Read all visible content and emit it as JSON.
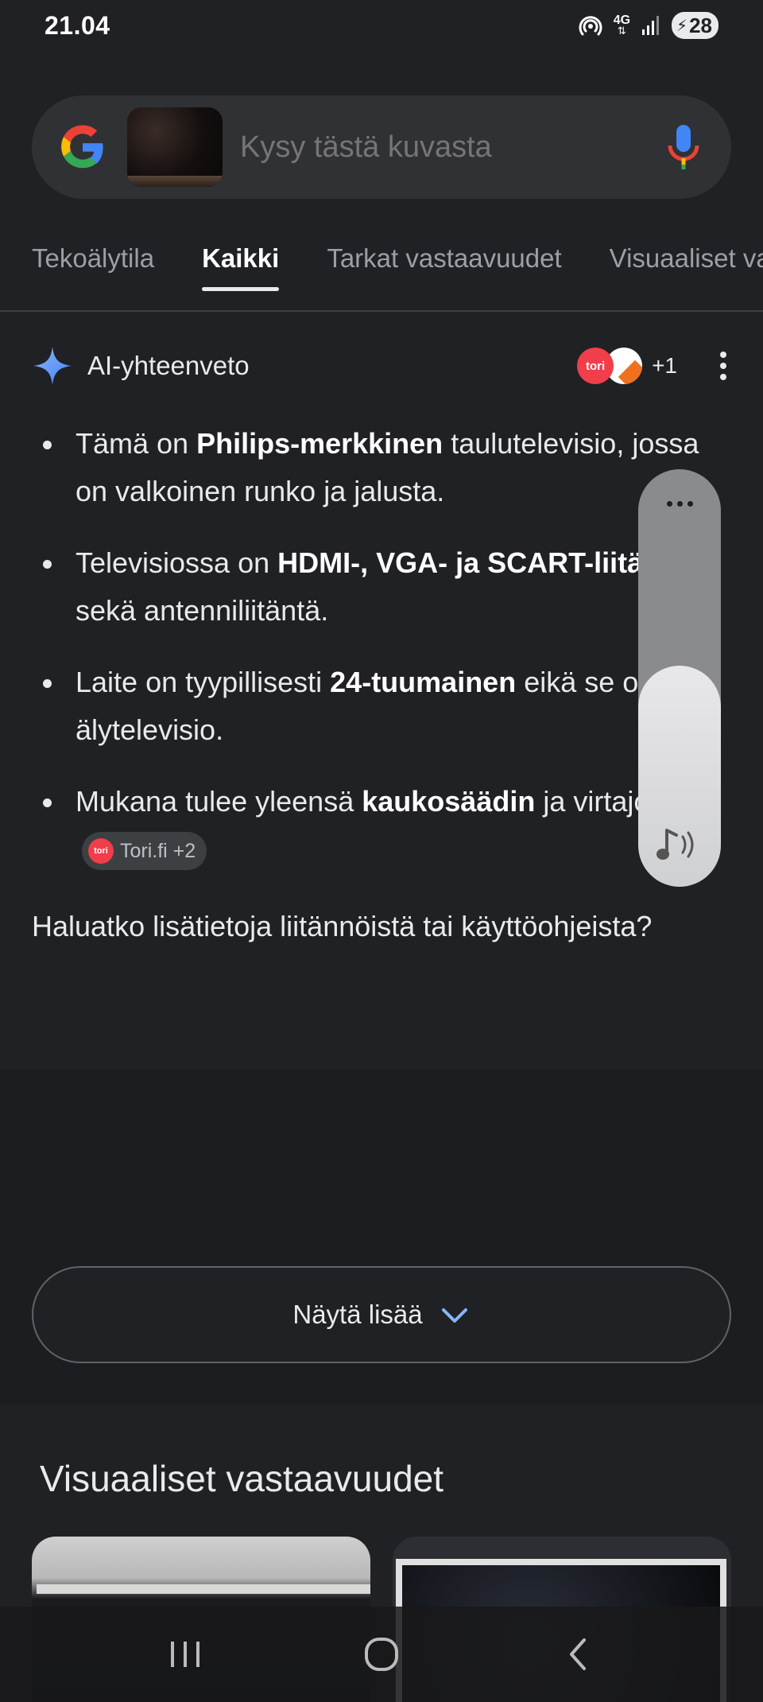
{
  "status": {
    "time": "21.04",
    "network": "4G",
    "battery": "28"
  },
  "search": {
    "placeholder": "Kysy tästä kuvasta"
  },
  "tabs": [
    {
      "label": "Tekoälytila",
      "active": false
    },
    {
      "label": "Kaikki",
      "active": true
    },
    {
      "label": "Tarkat vastaavuudet",
      "active": false
    },
    {
      "label": "Visuaaliset vastaavuudet",
      "active": false
    }
  ],
  "ai_overview": {
    "title": "AI-yhteenveto",
    "source_logo": "tori",
    "source_count": "+1",
    "bullets": [
      {
        "pre": "Tämä on ",
        "bold": "Philips-merkkinen",
        "post": " taulutelevisio, jossa on valkoinen runko ja jalusta."
      },
      {
        "pre": "Televisiossa on ",
        "bold": "HDMI-, VGA- ja SCART-liitännät",
        "post": " sekä antenniliitäntä."
      },
      {
        "pre": "Laite on tyypillisesti ",
        "bold": "24-tuumainen",
        "post": " eikä se ole älytelevisio."
      },
      {
        "pre": "Mukana tulee yleensä ",
        "bold": "kaukosäädin",
        "post": " ja virtajohto."
      }
    ],
    "citation": {
      "logo": "tori",
      "label": "Tori.fi +2"
    },
    "followup": "Haluatko lisätietoja liitännöistä tai käyttöohjeista?"
  },
  "show_more": {
    "label": "Näytä lisää"
  },
  "visual_matches": {
    "title": "Visuaaliset vastaavuudet"
  },
  "volume": {
    "level_fraction": 0.53
  },
  "colors": {
    "background": "#202124",
    "surface": "#303134",
    "accent_blue": "#8ab4f8",
    "tori_red": "#f03e4a"
  }
}
